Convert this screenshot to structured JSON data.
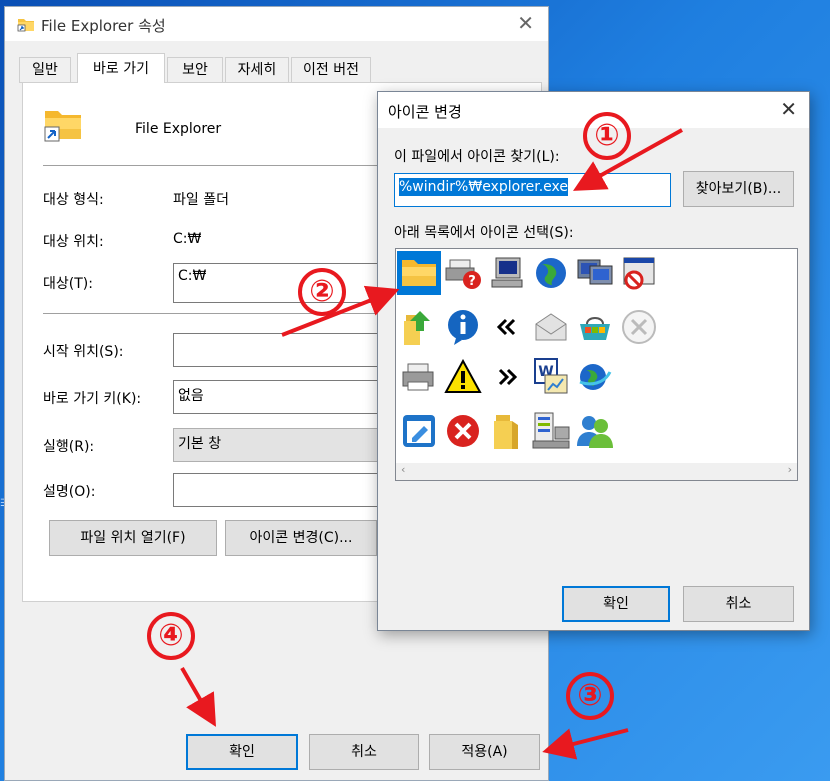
{
  "desktop": {
    "top_text": "…",
    "side_text": "∃"
  },
  "props": {
    "title": "File Explorer 속성",
    "tabs": [
      "일반",
      "바로 가기",
      "보안",
      "자세히",
      "이전 버전"
    ],
    "app_name": "File Explorer",
    "target_type_label": "대상 형식:",
    "target_type_value": "파일 폴더",
    "target_location_label": "대상 위치:",
    "target_location_value": "C:₩",
    "target_label": "대상(T):",
    "target_value": "C:₩",
    "start_in_label": "시작 위치(S):",
    "start_in_value": "",
    "shortcut_key_label": "바로 가기 키(K):",
    "shortcut_key_value": "없음",
    "run_label": "실행(R):",
    "run_value": "기본 창",
    "comment_label": "설명(O):",
    "comment_value": "",
    "open_location_button": "파일 위치 열기(F)",
    "change_icon_button": "아이콘 변경(C)...",
    "ok_button": "확인",
    "cancel_button": "취소",
    "apply_button": "적용(A)"
  },
  "dialog": {
    "title": "아이콘 변경",
    "find_label": "이 파일에서 아이콘 찾기(L):",
    "path_value": "%windir%₩explorer.exe",
    "browse_button": "찾아보기(B)...",
    "list_label": "아래 목록에서 아이콘 선택(S):",
    "ok_button": "확인",
    "cancel_button": "취소",
    "icons": [
      [
        "folder-icon",
        "printer-help-icon",
        "computer-terminal-icon",
        "globe-icon",
        "network-computers-icon",
        "blocked-window-icon"
      ],
      [
        "folder-arrow-icon",
        "info-icon",
        "double-chevron-left-icon",
        "envelope-icon",
        "shopping-basket-icon",
        "close-circle-icon"
      ],
      [
        "printer-icon",
        "warning-icon",
        "double-chevron-right-icon",
        "document-chart-icon",
        "globe-arrow-icon"
      ],
      [
        "window-edit-icon",
        "error-icon",
        "folder-open-icon",
        "server-computer-icon",
        "users-icon"
      ]
    ]
  },
  "annotations": {
    "one": "①",
    "two": "②",
    "three": "③",
    "four": "④",
    "color": "#e8191f"
  },
  "colors": {
    "accent": "#0078d7",
    "desktop": "#1f7fe0"
  }
}
